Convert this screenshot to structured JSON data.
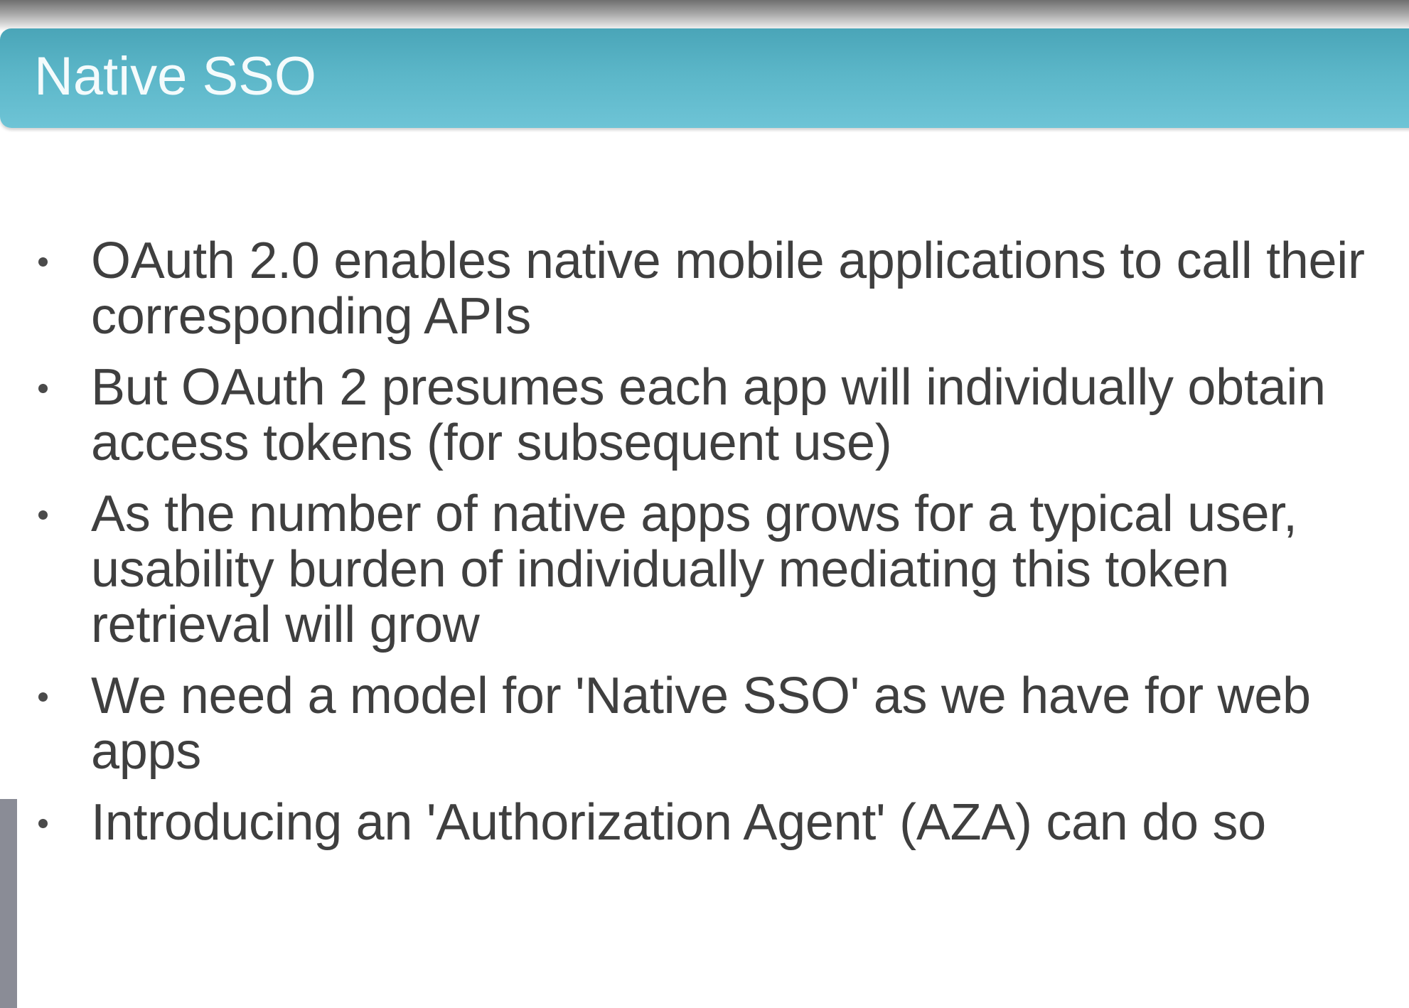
{
  "slide": {
    "title": "Native SSO",
    "bullets": [
      "OAuth 2.0 enables native mobile applications to call their corresponding APIs",
      "But OAuth 2 presumes each app will individually obtain access tokens (for subsequent use)",
      "As the number of native apps grows for a typical user, usability burden of individually mediating this token retrieval will grow",
      "We need a model for 'Native SSO' as we have for web apps",
      "Introducing an 'Authorization Agent' (AZA) can do so"
    ]
  },
  "colors": {
    "title_bar": "#5bb6c8",
    "title_text": "#f4fbfc",
    "body_text": "#3f3f3f"
  }
}
